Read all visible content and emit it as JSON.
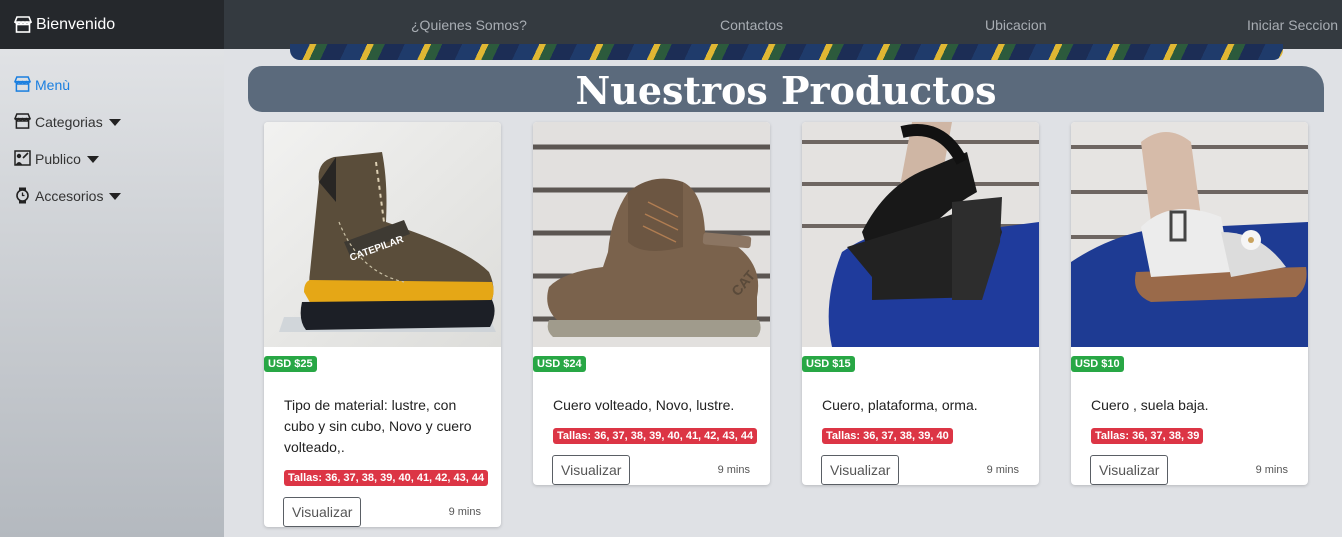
{
  "brand": {
    "title": "Bienvenido",
    "icon": "store-icon"
  },
  "nav": {
    "items": [
      "¿Quienes Somos?",
      "Contactos",
      "Ubicacion",
      "Iniciar Seccion"
    ]
  },
  "sidebar": {
    "items": [
      {
        "label": "Menù",
        "icon": "store-icon",
        "active": true
      },
      {
        "label": "Categorias",
        "icon": "store-icon"
      },
      {
        "label": "Publico",
        "icon": "person-board-icon"
      },
      {
        "label": "Accesorios",
        "icon": "watch-icon"
      }
    ]
  },
  "section": {
    "title": "Nuestros Productos"
  },
  "products": [
    {
      "price": "USD $25",
      "description": "Tipo de material: lustre, con cubo y sin cubo, Novo y cuero volteado,.",
      "sizes": "Tallas: 36, 37, 38, 39, 40, 41, 42, 43, 44",
      "button": "Visualizar",
      "time": "9 mins"
    },
    {
      "price": "USD $24",
      "description": "Cuero volteado, Novo, lustre.",
      "sizes": "Tallas: 36, 37, 38, 39, 40, 41, 42, 43, 44",
      "button": "Visualizar",
      "time": "9 mins"
    },
    {
      "price": "USD $15",
      "description": "Cuero, plataforma, orma.",
      "sizes": "Tallas: 36, 37, 38, 39, 40",
      "button": "Visualizar",
      "time": "9 mins"
    },
    {
      "price": "USD $10",
      "description": "Cuero , suela baja.",
      "sizes": "Tallas: 36, 37, 38, 39",
      "button": "Visualizar",
      "time": "9 mins"
    }
  ],
  "colors": {
    "navbar": "#343a40",
    "price_badge": "#28a745",
    "sizes_badge": "#dc3545",
    "header_band": "#5b6a7c",
    "active_link": "#1a7fe0"
  }
}
